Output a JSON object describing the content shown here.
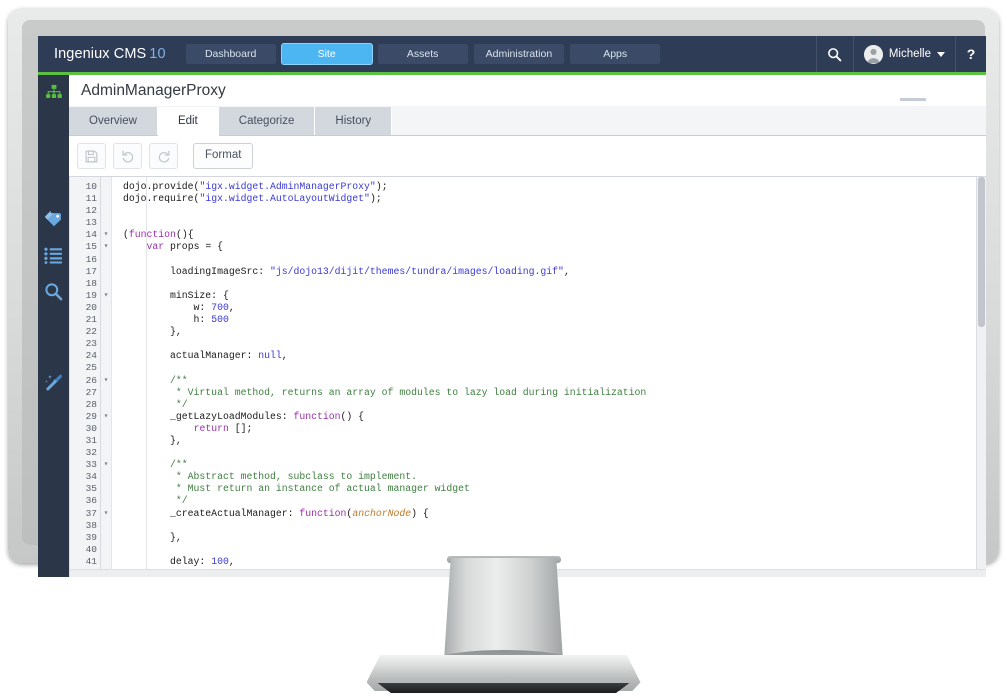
{
  "app": {
    "brand_name": "Ingeniux CMS",
    "brand_version": "10"
  },
  "header": {
    "nav_tabs": [
      {
        "label": "Dashboard",
        "active": false
      },
      {
        "label": "Site",
        "active": true
      },
      {
        "label": "Assets",
        "active": false
      },
      {
        "label": "Administration",
        "active": false
      },
      {
        "label": "Apps",
        "active": false
      }
    ],
    "search_icon": "search-icon",
    "user_name": "Michelle",
    "help_label": "?",
    "accent_green": "#5cc142",
    "accent_blue": "#4cb6f2",
    "bar_color": "#2f3c55"
  },
  "sidebar": {
    "items": [
      {
        "icon": "sitemap-icon",
        "color": "#5cc142"
      },
      {
        "icon": "tags-icon",
        "color": "#6aa9e0"
      },
      {
        "icon": "list-icon",
        "color": "#6aa9e0"
      },
      {
        "icon": "search-icon",
        "color": "#6aa9e0"
      },
      {
        "icon": "magic-wand-icon",
        "color": "#6aa9e0"
      }
    ]
  },
  "page": {
    "title": "AdminManagerProxy"
  },
  "doc_tabs": [
    {
      "label": "Overview",
      "active": false
    },
    {
      "label": "Edit",
      "active": true
    },
    {
      "label": "Categorize",
      "active": false
    },
    {
      "label": "History",
      "active": false
    }
  ],
  "toolbar": {
    "save_icon": "save-icon",
    "undo_icon": "undo-icon",
    "redo_icon": "redo-icon",
    "format_label": "Format"
  },
  "editor": {
    "first_line_number": 10,
    "lines": [
      {
        "n": 10,
        "fold": false,
        "tokens": [
          {
            "t": "dojo.provide(",
            "c": "plain"
          },
          {
            "t": "\"igx.widget.AdminManagerProxy\"",
            "c": "str"
          },
          {
            "t": ");",
            "c": "plain"
          }
        ]
      },
      {
        "n": 11,
        "fold": false,
        "tokens": [
          {
            "t": "dojo.require(",
            "c": "plain"
          },
          {
            "t": "\"igx.widget.AutoLayoutWidget\"",
            "c": "str"
          },
          {
            "t": ");",
            "c": "plain"
          }
        ]
      },
      {
        "n": 12,
        "fold": false,
        "tokens": []
      },
      {
        "n": 13,
        "fold": false,
        "tokens": []
      },
      {
        "n": 14,
        "fold": true,
        "tokens": [
          {
            "t": "(",
            "c": "plain"
          },
          {
            "t": "function",
            "c": "kw"
          },
          {
            "t": "(){",
            "c": "plain"
          }
        ]
      },
      {
        "n": 15,
        "fold": true,
        "tokens": [
          {
            "t": "    ",
            "c": "plain"
          },
          {
            "t": "var",
            "c": "kw"
          },
          {
            "t": " props = {",
            "c": "plain"
          }
        ]
      },
      {
        "n": 16,
        "fold": false,
        "tokens": []
      },
      {
        "n": 17,
        "fold": false,
        "tokens": [
          {
            "t": "        loadingImageSrc: ",
            "c": "plain"
          },
          {
            "t": "\"js/dojo13/dijit/themes/tundra/images/loading.gif\"",
            "c": "str"
          },
          {
            "t": ",",
            "c": "plain"
          }
        ]
      },
      {
        "n": 18,
        "fold": false,
        "tokens": []
      },
      {
        "n": 19,
        "fold": true,
        "tokens": [
          {
            "t": "        minSize: {",
            "c": "plain"
          }
        ]
      },
      {
        "n": 20,
        "fold": false,
        "tokens": [
          {
            "t": "            w: ",
            "c": "plain"
          },
          {
            "t": "700",
            "c": "num"
          },
          {
            "t": ",",
            "c": "plain"
          }
        ]
      },
      {
        "n": 21,
        "fold": false,
        "tokens": [
          {
            "t": "            h: ",
            "c": "plain"
          },
          {
            "t": "500",
            "c": "num"
          }
        ]
      },
      {
        "n": 22,
        "fold": false,
        "tokens": [
          {
            "t": "        },",
            "c": "plain"
          }
        ]
      },
      {
        "n": 23,
        "fold": false,
        "tokens": []
      },
      {
        "n": 24,
        "fold": false,
        "tokens": [
          {
            "t": "        actualManager: ",
            "c": "plain"
          },
          {
            "t": "null",
            "c": "num"
          },
          {
            "t": ",",
            "c": "plain"
          }
        ]
      },
      {
        "n": 25,
        "fold": false,
        "tokens": []
      },
      {
        "n": 26,
        "fold": true,
        "tokens": [
          {
            "t": "        /**",
            "c": "com"
          }
        ]
      },
      {
        "n": 27,
        "fold": false,
        "tokens": [
          {
            "t": "         * Virtual method, returns an array of modules to lazy load during initialization",
            "c": "com"
          }
        ]
      },
      {
        "n": 28,
        "fold": false,
        "tokens": [
          {
            "t": "         */",
            "c": "com"
          }
        ]
      },
      {
        "n": 29,
        "fold": true,
        "tokens": [
          {
            "t": "        _getLazyLoadModules: ",
            "c": "plain"
          },
          {
            "t": "function",
            "c": "kw"
          },
          {
            "t": "() {",
            "c": "plain"
          }
        ]
      },
      {
        "n": 30,
        "fold": false,
        "tokens": [
          {
            "t": "            ",
            "c": "plain"
          },
          {
            "t": "return",
            "c": "kw"
          },
          {
            "t": " [];",
            "c": "plain"
          }
        ]
      },
      {
        "n": 31,
        "fold": false,
        "tokens": [
          {
            "t": "        },",
            "c": "plain"
          }
        ]
      },
      {
        "n": 32,
        "fold": false,
        "tokens": []
      },
      {
        "n": 33,
        "fold": true,
        "tokens": [
          {
            "t": "        /**",
            "c": "com"
          }
        ]
      },
      {
        "n": 34,
        "fold": false,
        "tokens": [
          {
            "t": "         * Abstract method, subclass to implement.",
            "c": "com"
          }
        ]
      },
      {
        "n": 35,
        "fold": false,
        "tokens": [
          {
            "t": "         * Must return an instance of actual manager widget",
            "c": "com"
          }
        ]
      },
      {
        "n": 36,
        "fold": false,
        "tokens": [
          {
            "t": "         */",
            "c": "com"
          }
        ]
      },
      {
        "n": 37,
        "fold": true,
        "tokens": [
          {
            "t": "        _createActualManager: ",
            "c": "plain"
          },
          {
            "t": "function",
            "c": "kw"
          },
          {
            "t": "(",
            "c": "plain"
          },
          {
            "t": "anchorNode",
            "c": "arg"
          },
          {
            "t": ") {",
            "c": "plain"
          }
        ]
      },
      {
        "n": 38,
        "fold": false,
        "tokens": []
      },
      {
        "n": 39,
        "fold": false,
        "tokens": [
          {
            "t": "        },",
            "c": "plain"
          }
        ]
      },
      {
        "n": 40,
        "fold": false,
        "tokens": []
      },
      {
        "n": 41,
        "fold": false,
        "tokens": [
          {
            "t": "        delay: ",
            "c": "plain"
          },
          {
            "t": "100",
            "c": "num"
          },
          {
            "t": ",",
            "c": "plain"
          }
        ]
      }
    ]
  }
}
